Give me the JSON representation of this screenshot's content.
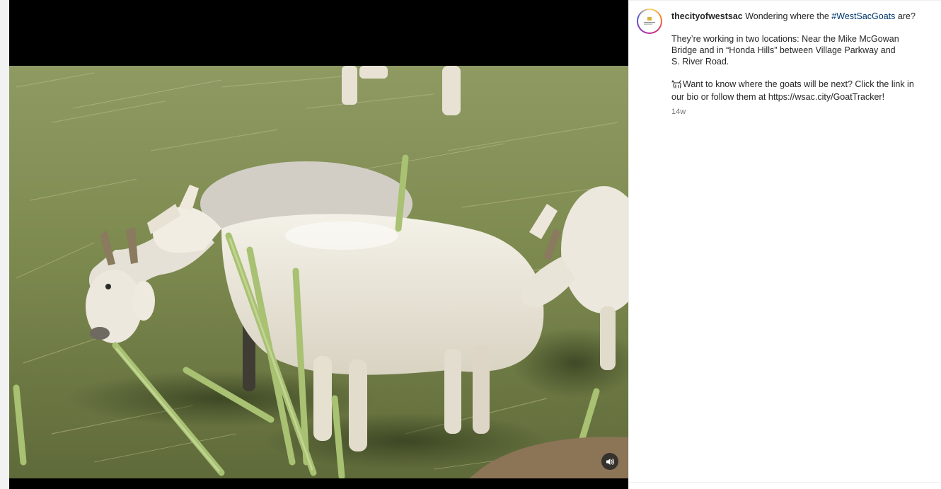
{
  "post": {
    "username": "thecityofwestsac",
    "caption_intro": "Wondering where the",
    "hashtag": "#WestSacGoats",
    "caption_intro_end": "are?",
    "paragraph1_lines": [
      "They’re working in two locations: Near the Mike McGowan",
      "Bridge and in “Honda Hills” between Village Parkway and",
      "S. River Road."
    ],
    "paragraph2_emoji_icon": "goat-icon",
    "paragraph2_lines": [
      "Want to know where the goats will be next? Click the link in",
      "our bio or follow them at https://wsac.city/GoatTracker!"
    ],
    "timestamp": "14w"
  },
  "media": {
    "type": "video",
    "mute_icon": "speaker-icon"
  },
  "colors": {
    "hashtag": "#00376b",
    "text": "#262626",
    "muted_text": "#737373",
    "media_background": "#000000"
  }
}
